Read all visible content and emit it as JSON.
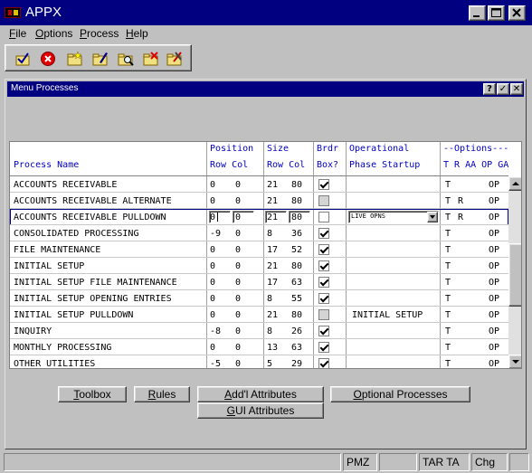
{
  "app": {
    "title": "APPX"
  },
  "window_buttons": {
    "minimize": "_",
    "maximize": "□",
    "close": "✕"
  },
  "menu": [
    {
      "label": "File",
      "u": "F"
    },
    {
      "label": "Options",
      "u": "O"
    },
    {
      "label": "Process",
      "u": "P"
    },
    {
      "label": "Help",
      "u": "H"
    }
  ],
  "toolbar": {
    "icons": [
      "check-folder-icon",
      "stop-icon",
      "new-folder-icon",
      "edit-folder-icon",
      "find-folder-icon",
      "delete-folder-icon",
      "tools-folder-icon"
    ]
  },
  "child": {
    "title": "Menu Processes",
    "buttons": {
      "help": "?",
      "ok": "✓",
      "close": "✕"
    }
  },
  "grid": {
    "headers": {
      "process_name": "Process Name",
      "position": "Position",
      "row_col_1": "Row Col",
      "size": "Size",
      "row_col_2": "Row Col",
      "brdr": "Brdr",
      "box": "Box?",
      "operational": "Operational",
      "phase_startup": "Phase Startup",
      "options": "--Options---",
      "options_cols": "T R AA OP GA"
    },
    "rows": [
      {
        "name": "ACCOUNTS RECEIVABLE",
        "prow": "0",
        "pcol": "0",
        "srow": "21",
        "scol": "80",
        "box": "on",
        "phase": "",
        "t": "T",
        "r": "",
        "op": "OP"
      },
      {
        "name": "ACCOUNTS RECEIVABLE ALTERNATE",
        "prow": "0",
        "pcol": "0",
        "srow": "21",
        "scol": "80",
        "box": "grey",
        "phase": "",
        "t": "T",
        "r": "R",
        "op": "OP"
      },
      {
        "name": "ACCOUNTS RECEIVABLE PULLDOWN",
        "prow": "0",
        "pcol": "0",
        "srow": "21",
        "scol": "80",
        "box": "off",
        "phase": "LIVE OPNS",
        "t": "T",
        "r": "R",
        "op": "OP"
      },
      {
        "name": "CONSOLIDATED PROCESSING",
        "prow": "-9",
        "pcol": "0",
        "srow": "8",
        "scol": "36",
        "box": "on",
        "phase": "",
        "t": "T",
        "r": "",
        "op": "OP"
      },
      {
        "name": "FILE MAINTENANCE",
        "prow": "0",
        "pcol": "0",
        "srow": "17",
        "scol": "52",
        "box": "on",
        "phase": "",
        "t": "T",
        "r": "",
        "op": "OP"
      },
      {
        "name": "INITIAL SETUP",
        "prow": "0",
        "pcol": "0",
        "srow": "21",
        "scol": "80",
        "box": "on",
        "phase": "",
        "t": "T",
        "r": "",
        "op": "OP"
      },
      {
        "name": "INITIAL SETUP FILE MAINTENANCE",
        "prow": "0",
        "pcol": "0",
        "srow": "17",
        "scol": "63",
        "box": "on",
        "phase": "",
        "t": "T",
        "r": "",
        "op": "OP"
      },
      {
        "name": "INITIAL SETUP OPENING ENTRIES",
        "prow": "0",
        "pcol": "0",
        "srow": "8",
        "scol": "55",
        "box": "on",
        "phase": "",
        "t": "T",
        "r": "",
        "op": "OP"
      },
      {
        "name": "INITIAL SETUP PULLDOWN",
        "prow": "0",
        "pcol": "0",
        "srow": "21",
        "scol": "80",
        "box": "grey",
        "phase": "INITIAL SETUP",
        "t": "T",
        "r": "",
        "op": "OP"
      },
      {
        "name": "INQUIRY",
        "prow": "-8",
        "pcol": "0",
        "srow": "8",
        "scol": "26",
        "box": "on",
        "phase": "",
        "t": "T",
        "r": "",
        "op": "OP"
      },
      {
        "name": "MONTHLY PROCESSING",
        "prow": "0",
        "pcol": "0",
        "srow": "13",
        "scol": "63",
        "box": "on",
        "phase": "",
        "t": "T",
        "r": "",
        "op": "OP"
      },
      {
        "name": "OTHER UTILITIES",
        "prow": "-5",
        "pcol": "0",
        "srow": "5",
        "scol": "29",
        "box": "on",
        "phase": "",
        "t": "T",
        "r": "",
        "op": "OP"
      }
    ]
  },
  "buttons": {
    "toolbox": "Toolbox",
    "rules": "Rules",
    "addl": "Add'l Attributes",
    "optional": "Optional Processes",
    "gui": "GUI Attributes"
  },
  "status": {
    "panel1": "PMZ",
    "panel2": "TAR TA",
    "panel3": "Chg"
  }
}
